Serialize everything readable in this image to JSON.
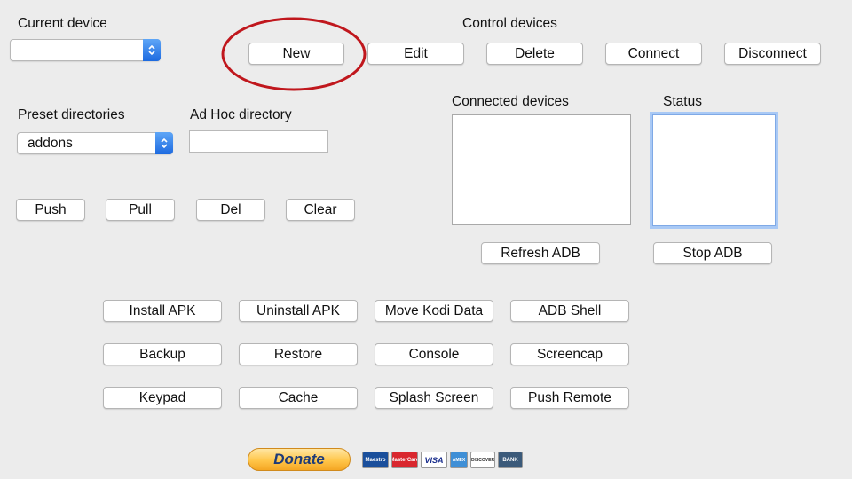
{
  "current_device": {
    "label": "Current device",
    "value": ""
  },
  "control_devices": {
    "label": "Control devices",
    "buttons": [
      "New",
      "Edit",
      "Delete",
      "Connect",
      "Disconnect"
    ]
  },
  "preset_directories": {
    "label": "Preset directories",
    "value": "addons"
  },
  "adhoc_directory": {
    "label": "Ad Hoc directory",
    "value": ""
  },
  "file_buttons": [
    "Push",
    "Pull",
    "Del",
    "Clear"
  ],
  "connected_devices": {
    "label": "Connected devices"
  },
  "status": {
    "label": "Status"
  },
  "adb_buttons": {
    "refresh": "Refresh ADB",
    "stop": "Stop ADB"
  },
  "action_buttons": [
    [
      "Install APK",
      "Uninstall APK",
      "Move Kodi Data",
      "ADB Shell"
    ],
    [
      "Backup",
      "Restore",
      "Console",
      "Screencap"
    ],
    [
      "Keypad",
      "Cache",
      "Splash Screen",
      "Push Remote"
    ]
  ],
  "donate": {
    "label": "Donate",
    "cards": [
      "Maestro",
      "MasterCard",
      "VISA",
      "AMEX",
      "DISCOVER",
      "BANK"
    ]
  },
  "colors": {
    "background": "#ececec",
    "select_arrow": "#2a78e4",
    "annotation_circle": "#c0171d",
    "focus_ring": "#a9c9f5"
  }
}
